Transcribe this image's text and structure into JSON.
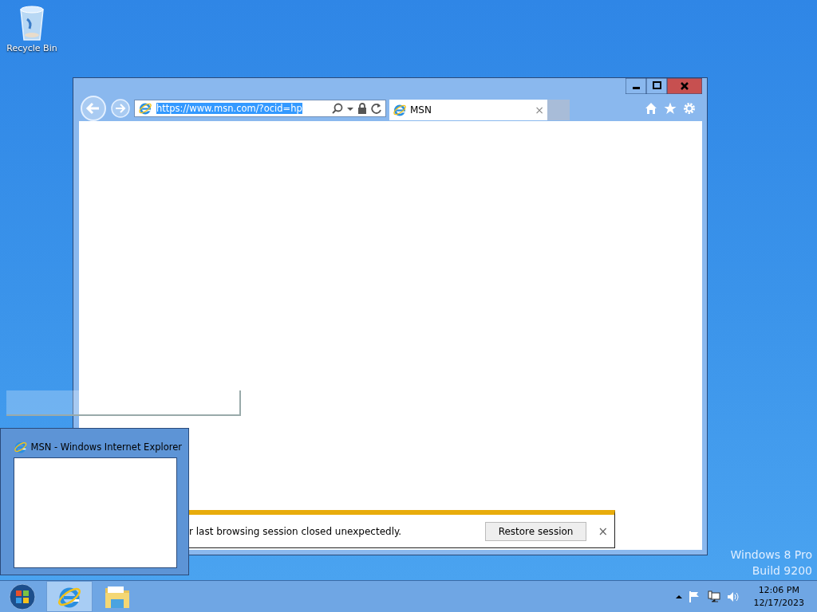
{
  "desktop_icons": [
    {
      "label": "Recycle Bin"
    }
  ],
  "browser": {
    "address": {
      "value": "https://www.msn.com/?ocid=hp",
      "selected": true
    },
    "tabs": [
      {
        "label": "MSN",
        "close": "×",
        "selected": true
      }
    ],
    "notification": {
      "message": "r last browsing session closed unexpectedly.",
      "button": "Restore session",
      "close": "×"
    }
  },
  "thumbnail": {
    "title": "MSN - Windows Internet Explorer"
  },
  "edition": [
    "Windows 8 Pro",
    "Build 9200"
  ],
  "taskbar": {
    "pins": [
      {
        "kind": "ie",
        "selected": true
      },
      {
        "kind": "explorer",
        "selected": false
      }
    ],
    "tray": {
      "time": "12:06 PM",
      "date": "12/17/2023"
    }
  }
}
